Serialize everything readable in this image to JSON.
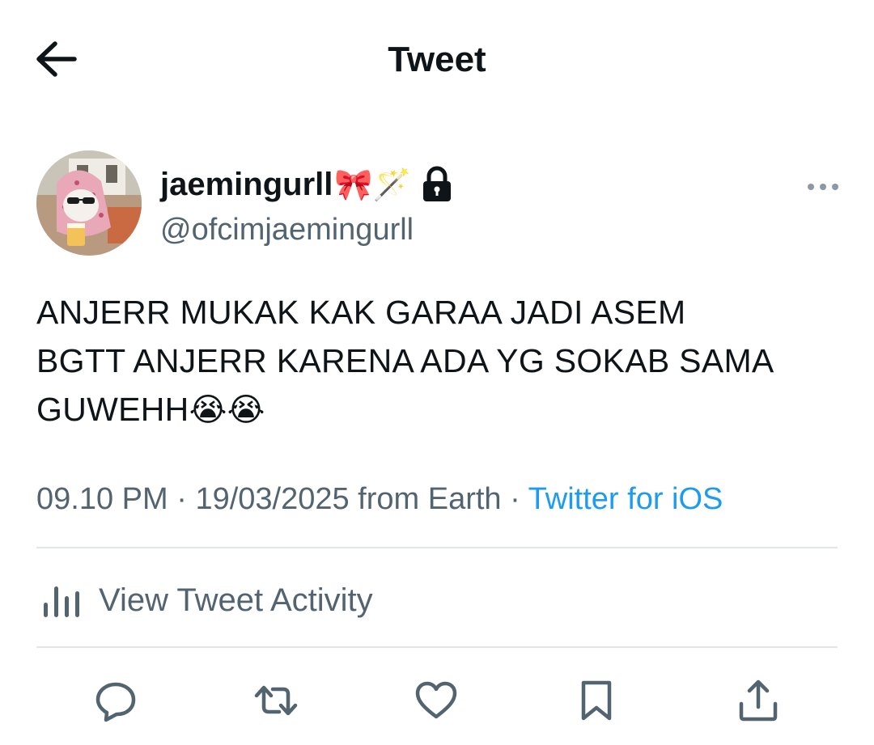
{
  "header": {
    "title": "Tweet",
    "back_icon": "arrow-left-icon"
  },
  "author": {
    "display_name": "jaemingurll",
    "name_emojis": "🎀🪄",
    "handle": "@ofcimjaemingurll",
    "protected_icon": "lock-icon",
    "avatar_icon": "avatar-cat-with-headscarf"
  },
  "tweet": {
    "lines": [
      "ANJERR MUKAK KAK GARAA JADI ASEM",
      "BGTT ANJERR KARENA ADA YG SOKAB SAMA",
      "GUWEHH"
    ],
    "trailing_emojis": "😭😭",
    "time": "09.10 PM",
    "separator": "·",
    "date_location": "19/03/2025 from Earth",
    "source": "Twitter for iOS"
  },
  "activity": {
    "label": "View Tweet Activity",
    "icon": "bar-chart-icon"
  },
  "actions": [
    {
      "name": "reply",
      "icon": "reply-icon"
    },
    {
      "name": "retweet",
      "icon": "retweet-icon"
    },
    {
      "name": "like",
      "icon": "heart-icon"
    },
    {
      "name": "bookmark",
      "icon": "bookmark-icon"
    },
    {
      "name": "share",
      "icon": "share-icon"
    }
  ],
  "colors": {
    "text": "#0f1419",
    "secondary": "#536471",
    "link": "#1d9bf0",
    "divider": "#e1e6ea"
  }
}
